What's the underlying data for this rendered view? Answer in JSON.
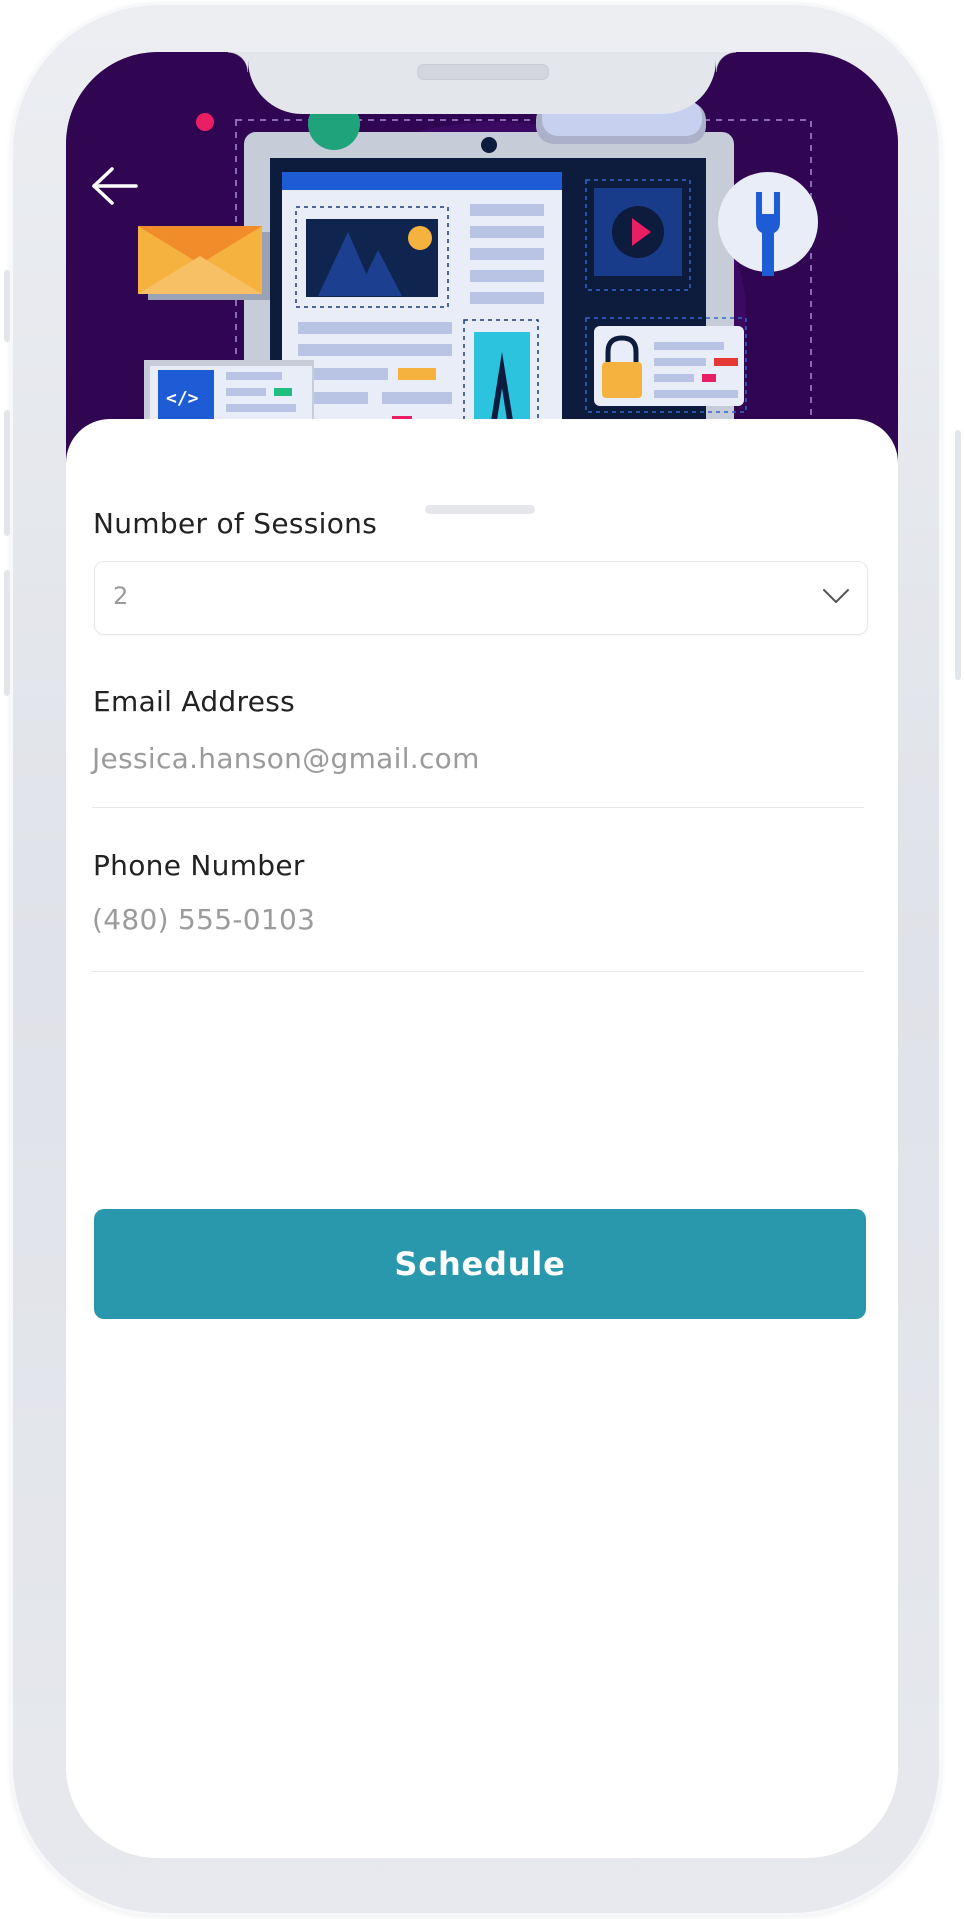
{
  "header": {
    "back_icon": "arrow-left-icon",
    "illustration": "web-design-illustration"
  },
  "form": {
    "sessions": {
      "label": "Number of Sessions",
      "value": "2",
      "icon": "chevron-down-icon"
    },
    "email": {
      "label": "Email Address",
      "value": "Jessica.hanson@gmail.com"
    },
    "phone": {
      "label": "Phone Number",
      "value": "(480) 555-0103"
    }
  },
  "actions": {
    "schedule_label": "Schedule"
  },
  "colors": {
    "hero_background": "#300652",
    "primary_button": "#2a98ac",
    "label_text": "#222222",
    "value_text": "#9b9b9b"
  }
}
